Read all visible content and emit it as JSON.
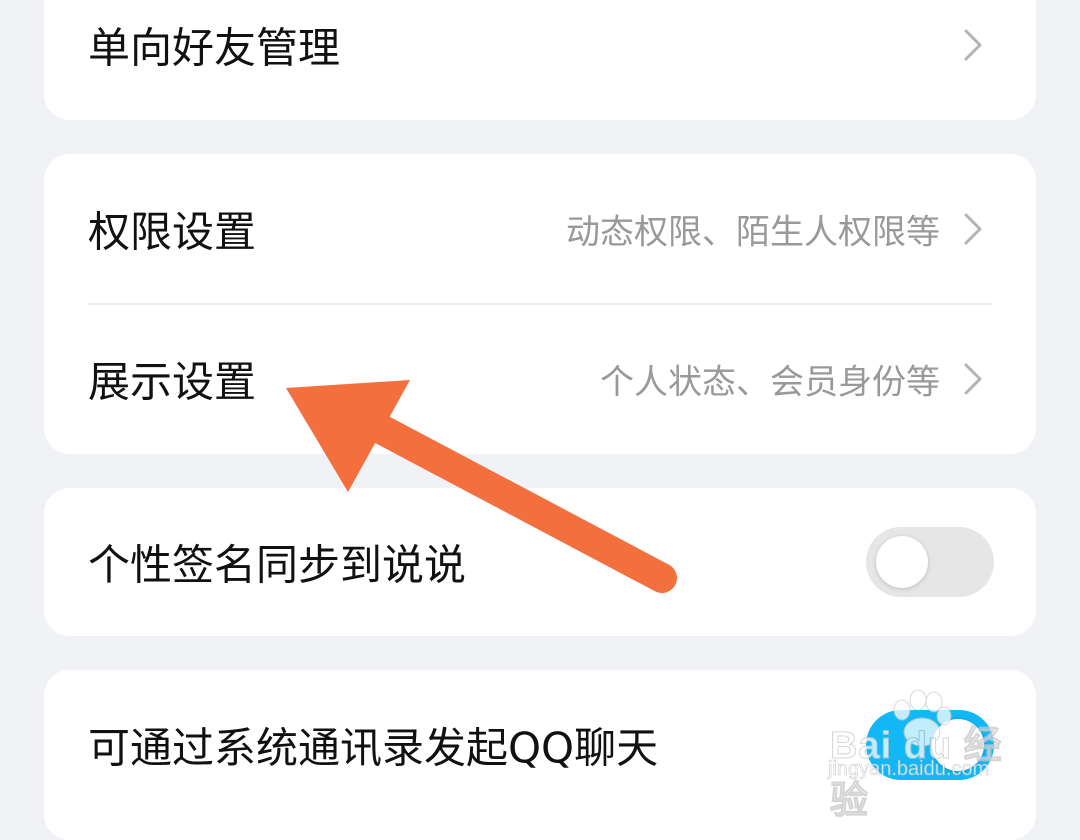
{
  "settings": {
    "one_way_friends": {
      "label": "单向好友管理"
    },
    "permissions": {
      "label": "权限设置",
      "value": "动态权限、陌生人权限等"
    },
    "display": {
      "label": "展示设置",
      "value": "个人状态、会员身份等"
    },
    "signature_sync": {
      "label": "个性签名同步到说说",
      "enabled": false
    },
    "contacts_chat": {
      "label": "可通过系统通讯录发起QQ聊天",
      "enabled": true
    }
  },
  "icons": {
    "chevron": "chevron-right-icon",
    "annotation": "arrow-annotation-icon"
  },
  "colors": {
    "background": "#f1f2f6",
    "card": "#ffffff",
    "label": "#111111",
    "secondary": "#999999",
    "toggle_off": "#e6e6e6",
    "toggle_on": "#12b7f5",
    "annotation_arrow": "#f46f3e"
  },
  "watermark": {
    "brand": "Bai du 经验",
    "url": "jingyan.baidu.com"
  }
}
